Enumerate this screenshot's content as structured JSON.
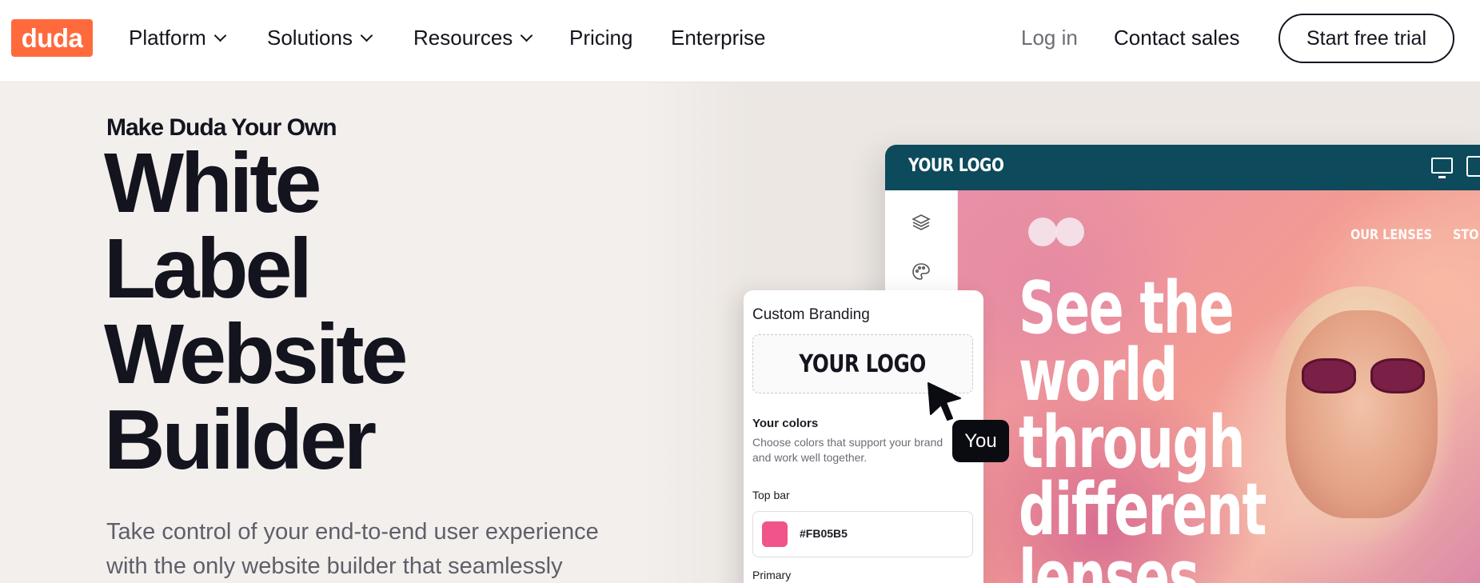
{
  "nav": {
    "logo": "duda",
    "platform": "Platform",
    "solutions": "Solutions",
    "resources": "Resources",
    "pricing": "Pricing",
    "enterprise": "Enterprise",
    "login": "Log in",
    "contact": "Contact sales",
    "trial": "Start free trial"
  },
  "hero": {
    "eyebrow": "Make Duda Your Own",
    "headline": [
      "White",
      "Label",
      "Website",
      "Builder"
    ],
    "subtext_1": "Take control of your end-to-end user experience",
    "subtext_2": "with the only website builder that seamlessly"
  },
  "editor": {
    "logo": "YOUR LOGO",
    "site_nav": [
      "OUR LENSES",
      "STO"
    ],
    "big_text": [
      "See the",
      "world",
      "through",
      "different",
      "lenses"
    ]
  },
  "branding_panel": {
    "title": "Custom Branding",
    "logo_placeholder": "YOUR LOGO",
    "colors_heading": "Your colors",
    "colors_desc_1": "Choose colors that support your brand",
    "colors_desc_2": "and work well together.",
    "top_bar_label": "Top bar",
    "top_bar_hex": "#FB05B5",
    "primary_label": "Primary"
  },
  "cursor_tag": "You",
  "colors": {
    "brand_orange": "#ff6a3d",
    "editor_bar": "#0c4a5c",
    "hero_bg": "#f3efec",
    "swatch": "#f0548b"
  },
  "icons": {
    "layers": "layers-icon",
    "palette": "palette-icon",
    "desktop": "monitor-icon",
    "tablet": "tablet-icon",
    "pointer": "cursor-arrow-icon"
  }
}
